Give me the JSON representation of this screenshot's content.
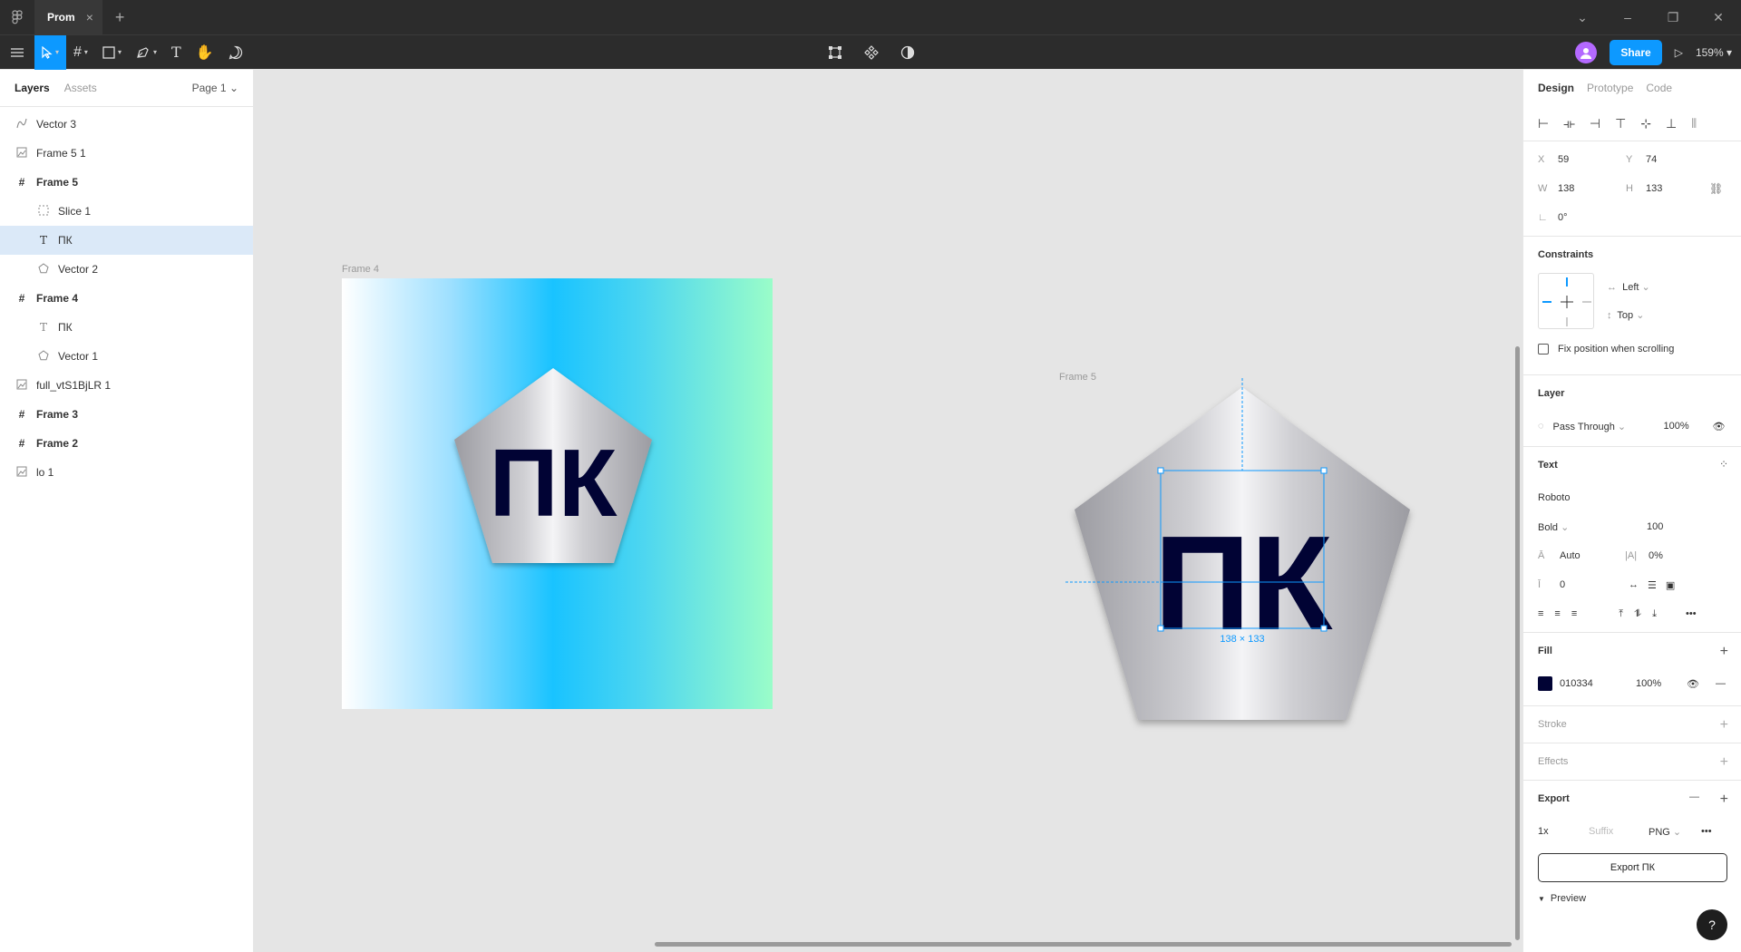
{
  "titlebar": {
    "tab_name": "Prom",
    "tab_close": "×",
    "new_tab": "+"
  },
  "toolbar": {
    "share_label": "Share",
    "zoom": "159%"
  },
  "left_panel": {
    "tabs": {
      "layers": "Layers",
      "assets": "Assets"
    },
    "page": "Page 1",
    "layers": [
      {
        "name": "Vector 3",
        "icon": "vector-icon"
      },
      {
        "name": "Frame 5 1",
        "icon": "image-icon"
      },
      {
        "name": "Frame 5",
        "icon": "frame-icon"
      },
      {
        "name": "Slice 1",
        "icon": "slice-icon"
      },
      {
        "name": "ПК",
        "icon": "text-icon"
      },
      {
        "name": "Vector 2",
        "icon": "polygon-icon"
      },
      {
        "name": "Frame 4",
        "icon": "frame-icon"
      },
      {
        "name": "ПК",
        "icon": "text-icon"
      },
      {
        "name": "Vector 1",
        "icon": "polygon-icon"
      },
      {
        "name": "full_vtS1BjLR 1",
        "icon": "image-icon"
      },
      {
        "name": "Frame 3",
        "icon": "frame-icon"
      },
      {
        "name": "Frame 2",
        "icon": "frame-icon"
      },
      {
        "name": "lo 1",
        "icon": "image-icon"
      }
    ]
  },
  "canvas": {
    "frame4_label": "Frame 4",
    "frame5_label": "Frame 5",
    "logo_text": "ПК",
    "selection_size": "138 × 133",
    "text_color": "#010334"
  },
  "right_panel": {
    "tabs": {
      "design": "Design",
      "prototype": "Prototype",
      "code": "Code"
    },
    "position": {
      "x_label": "X",
      "x": "59",
      "y_label": "Y",
      "y": "74",
      "w_label": "W",
      "w": "138",
      "h_label": "H",
      "h": "133",
      "rotation": "0°"
    },
    "constraints": {
      "title": "Constraints",
      "horizontal": "Left",
      "vertical": "Top",
      "fix_scroll": "Fix position when scrolling"
    },
    "layer": {
      "title": "Layer",
      "blend": "Pass Through",
      "opacity": "100%"
    },
    "text": {
      "title": "Text",
      "font": "Roboto",
      "weight": "Bold",
      "size": "100",
      "line_height": "Auto",
      "letter_spacing": "0%",
      "paragraph": "0"
    },
    "fill": {
      "title": "Fill",
      "hex": "010334",
      "opacity": "100%"
    },
    "stroke": {
      "title": "Stroke"
    },
    "effects": {
      "title": "Effects"
    },
    "export": {
      "title": "Export",
      "scale": "1x",
      "suffix_placeholder": "Suffix",
      "format": "PNG",
      "button": "Export ПК",
      "preview": "Preview"
    }
  },
  "help": "?"
}
